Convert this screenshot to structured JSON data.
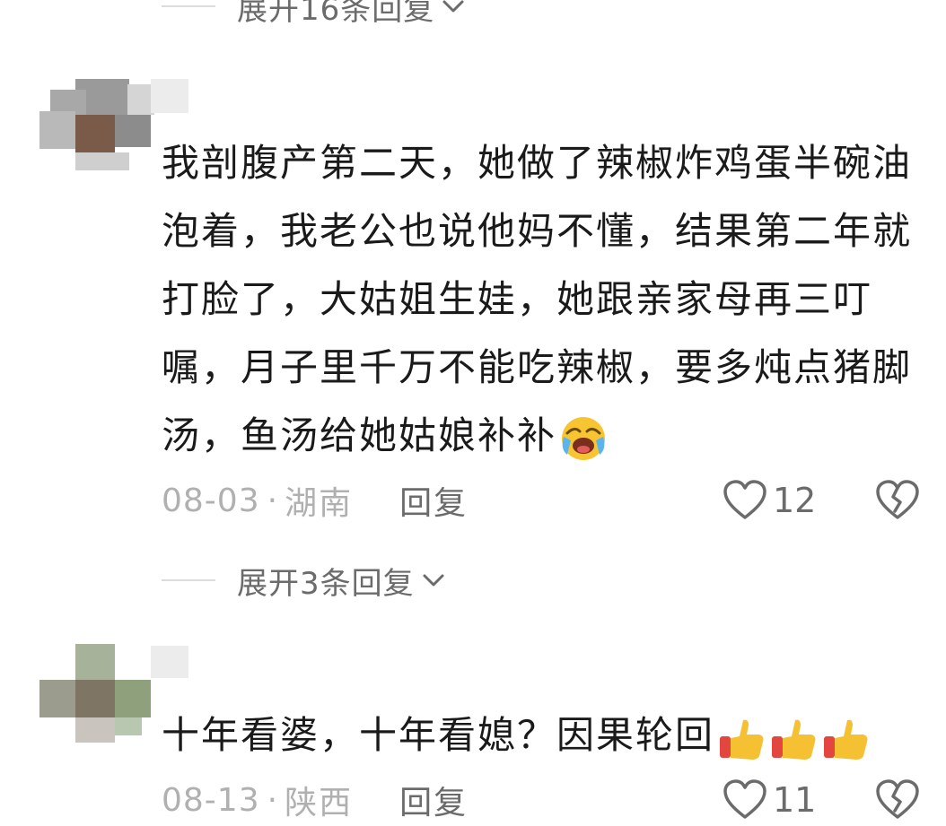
{
  "top_expand": {
    "label": "展开16条回复"
  },
  "comments": [
    {
      "text": "我剖腹产第二天，她做了辣椒炸鸡蛋半碗油泡着，我老公也说他妈不懂，结果第二年就打脸了，大姑姐生娃，她跟亲家母再三叮嘱，月子里千万不能吃辣椒，要多炖点猪脚汤，鱼汤给她姑娘补补",
      "emoji": "loudly-crying-face",
      "date": "08-03",
      "location": "湖南",
      "reply_label": "回复",
      "like_count": "12",
      "expand_label": "展开3条回复"
    },
    {
      "text": "十年看婆，十年看媳？因果轮回",
      "emoji": "thumbs-up x3",
      "date": "08-13",
      "location": "陕西",
      "reply_label": "回复",
      "like_count": "11"
    }
  ],
  "colors": {
    "body_text": "#1a1a1a",
    "meta_text": "#b0b0b0",
    "action_text": "#6b6b6b",
    "divider": "#dcdcdc"
  }
}
